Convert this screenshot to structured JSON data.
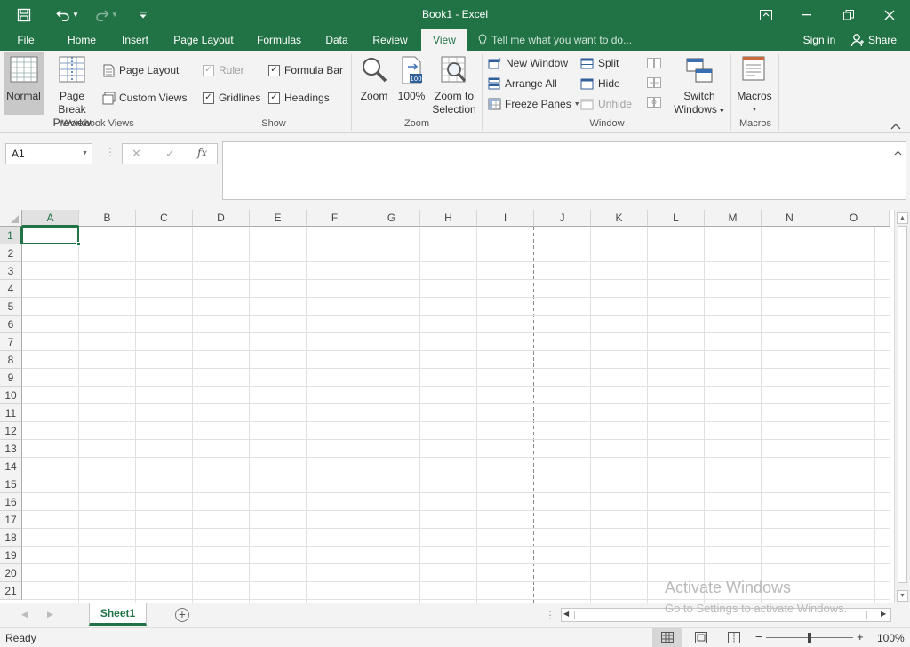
{
  "window": {
    "title": "Book1 - Excel",
    "accent": "#217346"
  },
  "qat": {
    "save_icon": "save-icon",
    "undo_icon": "undo-icon",
    "redo_icon": "redo-icon",
    "customize_icon": "customize-qat-icon"
  },
  "tabs": {
    "file": "File",
    "home": "Home",
    "insert": "Insert",
    "page_layout": "Page Layout",
    "formulas": "Formulas",
    "data": "Data",
    "review": "Review",
    "view": "View",
    "tell_me": "Tell me what you want to do...",
    "sign_in": "Sign in",
    "share": "Share",
    "active": "View"
  },
  "ribbon": {
    "workbook_views": {
      "label": "Workbook Views",
      "normal": "Normal",
      "page_break_line1": "Page Break",
      "page_break_line2": "Preview",
      "page_layout": "Page Layout",
      "custom_views": "Custom Views"
    },
    "show": {
      "label": "Show",
      "ruler": "Ruler",
      "gridlines": "Gridlines",
      "formula_bar": "Formula Bar",
      "headings": "Headings",
      "ruler_checked": true,
      "gridlines_checked": true,
      "formula_bar_checked": true,
      "headings_checked": true
    },
    "zoom": {
      "label": "Zoom",
      "zoom": "Zoom",
      "hundred": "100%",
      "zoom_to_line1": "Zoom to",
      "zoom_to_line2": "Selection"
    },
    "window": {
      "label": "Window",
      "new_window": "New Window",
      "arrange_all": "Arrange All",
      "freeze_panes": "Freeze Panes",
      "split": "Split",
      "hide": "Hide",
      "unhide": "Unhide",
      "switch_line1": "Switch",
      "switch_line2": "Windows"
    },
    "macros": {
      "label": "Macros",
      "macros": "Macros"
    }
  },
  "formula_bar": {
    "name_box": "A1",
    "fx": "fx",
    "cancel": "✕",
    "enter": "✓",
    "value": ""
  },
  "sheet": {
    "columns": [
      "A",
      "B",
      "C",
      "D",
      "E",
      "F",
      "G",
      "H",
      "I",
      "J",
      "K",
      "L",
      "M",
      "N",
      "O"
    ],
    "rows": [
      "1",
      "2",
      "3",
      "4",
      "5",
      "6",
      "7",
      "8",
      "9",
      "10",
      "11",
      "12",
      "13",
      "14",
      "15",
      "16",
      "17",
      "18",
      "19",
      "20",
      "21"
    ],
    "active_cell": "A1",
    "page_break_after_column": "I"
  },
  "sheet_tabs": {
    "active": "Sheet1",
    "add_icon": "add-sheet-icon"
  },
  "status": {
    "ready": "Ready",
    "zoom": "100%",
    "zoom_minus": "−",
    "zoom_plus": "+"
  },
  "watermark": {
    "line1": "Activate Windows",
    "line2": "Go to Settings to activate Windows."
  }
}
